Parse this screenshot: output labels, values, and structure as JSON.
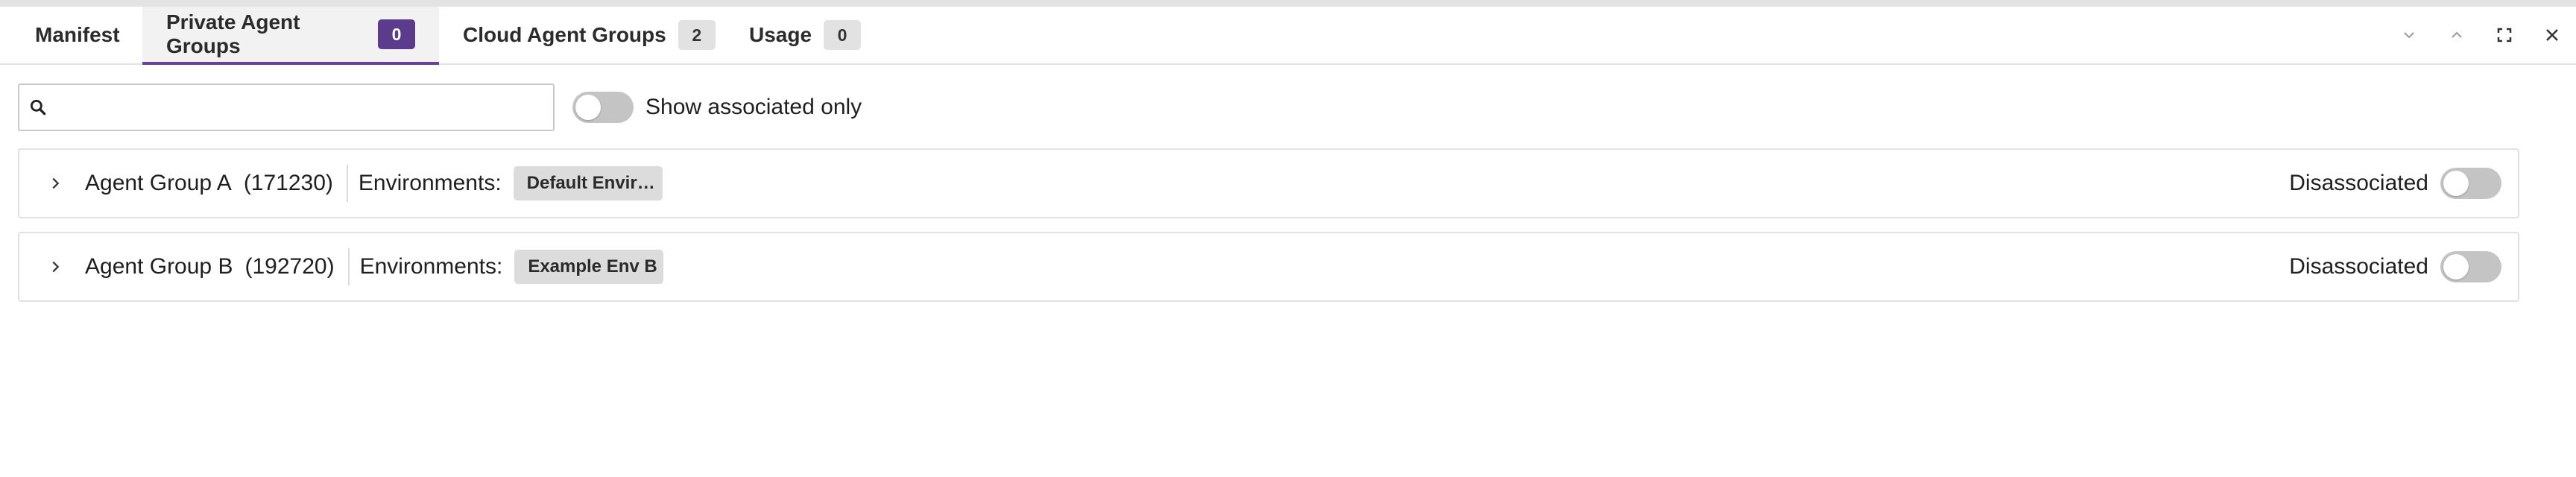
{
  "tabs": [
    {
      "label": "Manifest"
    },
    {
      "label": "Private Agent Groups",
      "count": "0"
    },
    {
      "label": "Cloud Agent Groups",
      "count": "2"
    },
    {
      "label": "Usage",
      "count": "0"
    }
  ],
  "active_tab": "Private Agent Groups",
  "window_controls": [
    "chevron-down-icon",
    "chevron-up-icon",
    "fullscreen-icon",
    "close-icon"
  ],
  "search": {
    "value": "",
    "placeholder": ""
  },
  "filter": {
    "label": "Show associated only",
    "checked": false
  },
  "groups": [
    {
      "name": "Agent Group A",
      "id": "(171230)",
      "env_label": "Environments:",
      "env": "Default Envir…",
      "status": "Disassociated",
      "associated": false
    },
    {
      "name": "Agent Group B",
      "id": "(192720)",
      "env_label": "Environments:",
      "env": "Example Env B",
      "status": "Disassociated",
      "associated": false
    }
  ],
  "colors": {
    "accent": "#5b3b8c",
    "tab_underline": "#6a3f9e",
    "chip_bg": "#dcdcdc",
    "toggle_off": "#c4c4c4"
  }
}
